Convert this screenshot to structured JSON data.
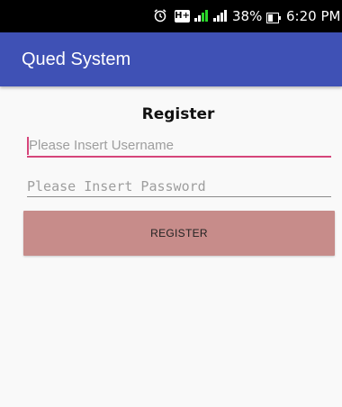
{
  "status_bar": {
    "network_badge": "H+",
    "battery_percent": "38%",
    "time": "6:20 PM",
    "icons": [
      "alarm-icon",
      "hplus-icon",
      "signal-icon",
      "signal-icon",
      "battery-icon"
    ]
  },
  "app_bar": {
    "title": "Qued System",
    "color": "#3f51b5"
  },
  "form": {
    "heading": "Register",
    "username": {
      "value": "",
      "placeholder": "Please Insert Username"
    },
    "password": {
      "value": "",
      "placeholder": "Please Insert Password"
    },
    "register_button_label": "REGISTER",
    "accent_color": "#d6457a",
    "button_color": "#c78c8a"
  }
}
